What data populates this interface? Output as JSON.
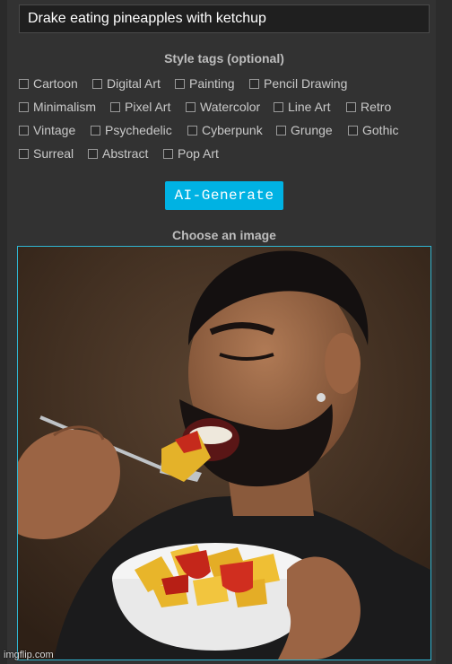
{
  "prompt": {
    "value": "Drake eating pineapples with ketchup"
  },
  "style_tags": {
    "title": "Style tags (optional)",
    "rows": [
      [
        "Cartoon",
        "Digital Art",
        "Painting",
        "Pencil Drawing"
      ],
      [
        "Minimalism",
        "Pixel Art",
        "Watercolor",
        "Line Art",
        "Retro"
      ],
      [
        "Vintage",
        "Psychedelic",
        "Cyberpunk",
        "Grunge",
        "Gothic"
      ],
      [
        "Surreal",
        "Abstract",
        "Pop Art"
      ]
    ]
  },
  "generate_button": {
    "label": "AI-Generate"
  },
  "image_section": {
    "title": "Choose an image"
  },
  "watermark": {
    "text": "imgflip.com"
  },
  "colors": {
    "accent": "#00b2e3",
    "frame_border": "#2fb6d3",
    "background": "#323232"
  }
}
